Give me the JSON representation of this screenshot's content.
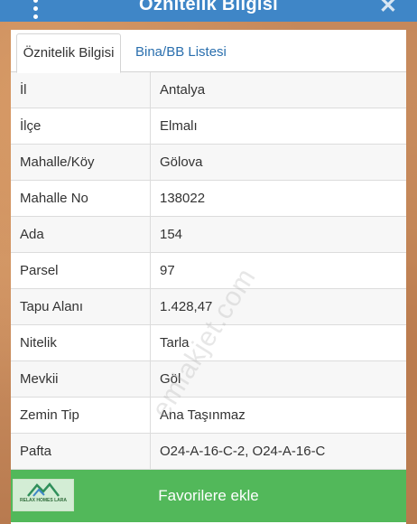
{
  "header": {
    "title": "Öznitelik Bilgisi",
    "menu_icon": "vertical-dots-icon",
    "close_label": "✕"
  },
  "tabs": [
    {
      "label": "Öznitelik Bilgisi",
      "active": true
    },
    {
      "label": "Bina/BB Listesi",
      "active": false
    }
  ],
  "attributes": [
    {
      "key": "İl",
      "value": "Antalya"
    },
    {
      "key": "İlçe",
      "value": "Elmalı"
    },
    {
      "key": "Mahalle/Köy",
      "value": "Gölova"
    },
    {
      "key": "Mahalle No",
      "value": "138022"
    },
    {
      "key": "Ada",
      "value": "154"
    },
    {
      "key": "Parsel",
      "value": "97"
    },
    {
      "key": "Tapu Alanı",
      "value": "1.428,47"
    },
    {
      "key": "Nitelik",
      "value": "Tarla"
    },
    {
      "key": "Mevkii",
      "value": "Göl"
    },
    {
      "key": "Zemin Tip",
      "value": "Ana Taşınmaz"
    },
    {
      "key": "Pafta",
      "value": "O24-A-16-C-2, O24-A-16-C"
    }
  ],
  "favorite_button": {
    "label": "Favorilere ekle"
  },
  "logo": {
    "text": "RELAX HOMES LARA"
  },
  "watermark": "emlakjet.com",
  "colors": {
    "header": "#3f86c7",
    "button": "#52b85a",
    "link": "#2a6fae"
  }
}
